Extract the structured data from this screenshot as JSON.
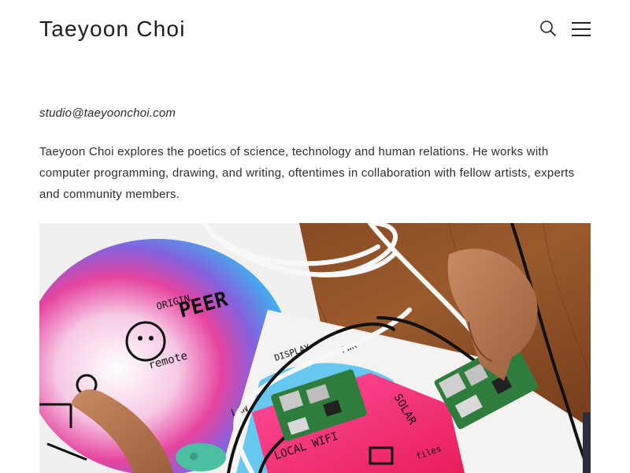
{
  "header": {
    "title": "Taeyoon Choi",
    "search_icon": "search-icon",
    "menu_icon": "hamburger-menu-icon"
  },
  "main": {
    "email": "studio@taeyoonchoi.com",
    "bio": "Taeyoon Choi explores the poetics of science, technology and human relations. He works with computer programming, drawing, and writing, oftentimes in collaboration with fellow artists, experts and community members.",
    "hero_image": {
      "subject": "photo-hands-raspberry-pi-boards-cables-on-drawings",
      "drawing_text": [
        "PEER",
        "ORIGIN",
        "remote",
        "DISPLAY",
        "PWR",
        "LAN",
        "LOCAL WIFI",
        "SOLAR",
        "files"
      ]
    }
  },
  "colors": {
    "text": "#222222",
    "background": "#ffffff",
    "wood": "#8a4a22",
    "magenta": "#f0287a",
    "cyan": "#38b7ea",
    "board_green": "#2f7d3c"
  }
}
